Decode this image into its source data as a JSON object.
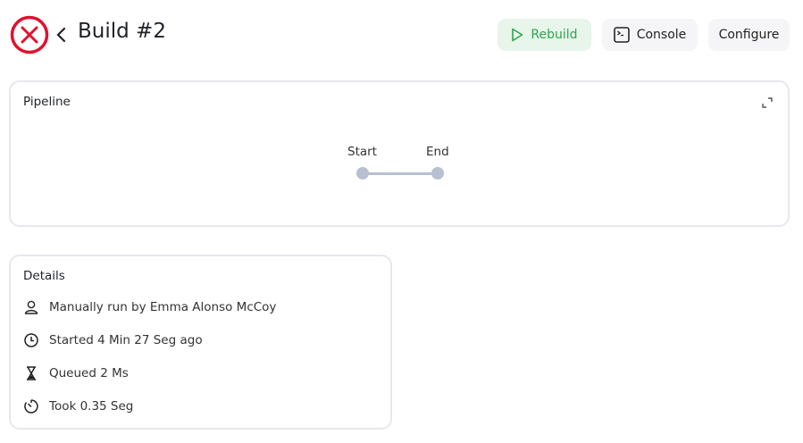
{
  "header": {
    "title": "Build #2",
    "status": "failed",
    "status_icon": "x-circle-icon",
    "status_color": "#e0122f"
  },
  "actions": {
    "rebuild": "Rebuild",
    "console": "Console",
    "configure": "Configure",
    "rebuild_color": "#2ea44f"
  },
  "pipeline": {
    "title": "Pipeline",
    "stages": [
      "Start",
      "End"
    ]
  },
  "details": {
    "title": "Details",
    "items": [
      {
        "icon": "user-icon",
        "text": "Manually run by Emma Alonso McCoy"
      },
      {
        "icon": "clock-icon",
        "text": "Started 4 Min 27 Seg ago"
      },
      {
        "icon": "hourglass-icon",
        "text": "Queued 2 Ms"
      },
      {
        "icon": "timer-icon",
        "text": "Took 0.35 Seg"
      }
    ]
  }
}
